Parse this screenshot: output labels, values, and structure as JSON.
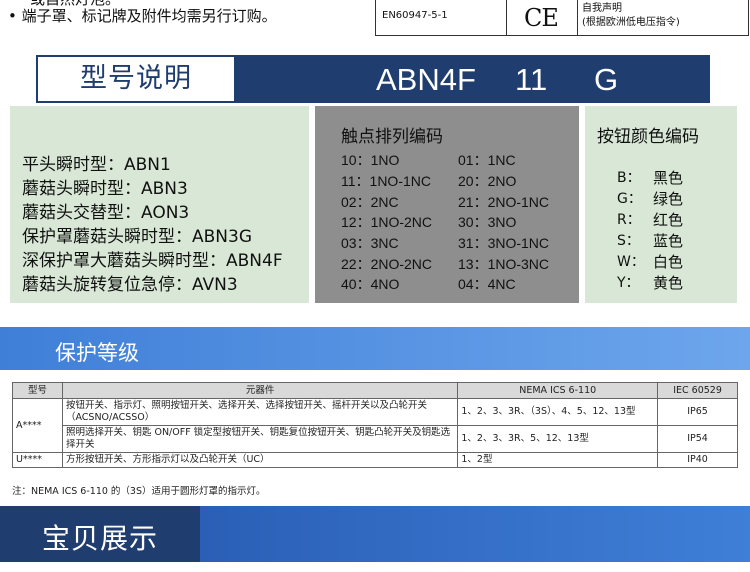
{
  "top_notes": {
    "line0": "或自然灯泡。",
    "line1": "• 端子罩、标记牌及附件均需另行订购。"
  },
  "certification": {
    "standard": "EN60947-5-1",
    "mark": "CE",
    "declaration_line1": "自我声明",
    "declaration_line2": "(根据欧洲低电压指令)"
  },
  "model_banner": {
    "label": "型号说明",
    "code_parts": [
      "ABN4F",
      "11",
      "G"
    ]
  },
  "types": {
    "items": [
      "平头瞬时型：ABN1",
      "蘑菇头瞬时型：ABN3",
      "蘑菇头交替型：AON3",
      "保护罩蘑菇头瞬时型：ABN3G",
      "深保护罩大蘑菇头瞬时型：ABN4F",
      "蘑菇头旋转复位急停：AVN3"
    ]
  },
  "contacts": {
    "title": "触点排列编码",
    "left": [
      "10：1NO",
      "11：1NO-1NC",
      "02：2NC",
      "12：1NO-2NC",
      "03：3NC",
      "22：2NO-2NC",
      "40：4NO"
    ],
    "right": [
      "01：1NC",
      "20：2NO",
      "21：2NO-1NC",
      "30：3NO",
      "31：3NO-1NC",
      "13：1NO-3NC",
      "04：4NC"
    ]
  },
  "colors": {
    "title": "按钮颜色编码",
    "items": [
      {
        "code": "B：",
        "name": "黑色"
      },
      {
        "code": "G：",
        "name": "绿色"
      },
      {
        "code": "R：",
        "name": "红色"
      },
      {
        "code": "S：",
        "name": "蓝色"
      },
      {
        "code": "W：",
        "name": "白色"
      },
      {
        "code": "Y：",
        "name": "黄色"
      }
    ]
  },
  "protection": {
    "title": "保护等级",
    "headers": [
      "型号",
      "元器件",
      "NEMA ICS 6-110",
      "IEC 60529"
    ],
    "rows": [
      {
        "model": "A****",
        "component": "按钮开关、指示灯、照明按钮开关、选择开关、选择按钮开关、摇杆开关以及凸轮开关（ACSNO/ACSSO）",
        "nema": "1、2、3、3R、（3S）、4、5、12、13型",
        "iec": "IP65"
      },
      {
        "model": "",
        "component": "照明选择开关、钥匙 ON/OFF 锁定型按钮开关、钥匙复位按钮开关、钥匙凸轮开关及钥匙选择开关",
        "nema": "1、2、3、3R、5、12、13型",
        "iec": "IP54"
      },
      {
        "model": "U****",
        "component": "方形按钮开关、方形指示灯以及凸轮开关（UC）",
        "nema": "1、2型",
        "iec": "IP40"
      }
    ],
    "note": "注：NEMA ICS 6-110 的（3S）适用于圆形灯罩的指示灯。"
  },
  "showcase": {
    "title": "宝贝展示"
  },
  "colors_theme": {
    "navy": "#1f3d6e",
    "blue": "#3f7fd8",
    "panel_green": "#d9e8d6",
    "panel_gray": "#8e8e8e"
  }
}
